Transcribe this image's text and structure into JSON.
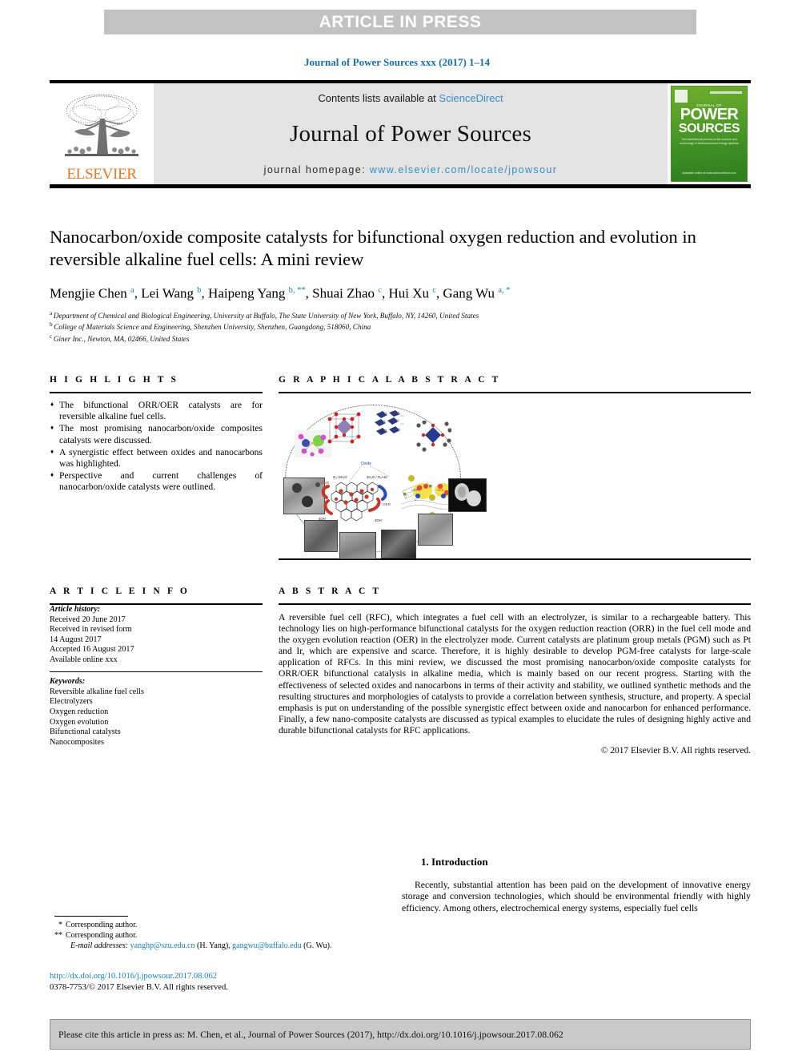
{
  "banner": {
    "text": "ARTICLE IN PRESS"
  },
  "running_head": "Journal of Power Sources xxx (2017) 1–14",
  "masthead": {
    "contents_prefix": "Contents lists available at ",
    "sciencedirect": "ScienceDirect",
    "journal_name": "Journal of Power Sources",
    "homepage_prefix": "journal homepage: ",
    "homepage_url": "www.elsevier.com/locate/jpowsour",
    "publisher_logo_text": "ELSEVIER",
    "publisher_logo_icon": "elsevier-tree-icon",
    "cover": {
      "kicker": "JOURNAL OF",
      "title_line1": "POWER",
      "title_line2": "SOURCES",
      "subtitle": "The international journal on the science and technology of electrochemical energy systems",
      "footer": "Available online at www.sciencedirect.com",
      "accent_color": "#4a9b28"
    }
  },
  "article": {
    "title": "Nanocarbon/oxide composite catalysts for bifunctional oxygen reduction and evolution in reversible alkaline fuel cells: A mini review",
    "authors": [
      {
        "name": "Mengjie Chen",
        "marks": "a",
        "sep": ", "
      },
      {
        "name": "Lei Wang",
        "marks": "b",
        "sep": ", "
      },
      {
        "name": "Haipeng Yang",
        "marks": "b, **",
        "sep": ", "
      },
      {
        "name": "Shuai Zhao",
        "marks": "c",
        "sep": ", "
      },
      {
        "name": "Hui Xu",
        "marks": "c",
        "sep": ", "
      },
      {
        "name": "Gang Wu",
        "marks": "a, *",
        "sep": ""
      }
    ],
    "affiliations": [
      {
        "mark": "a",
        "text": "Department of Chemical and Biological Engineering, University at Buffalo, The State University of New York, Buffalo, NY, 14260, United States"
      },
      {
        "mark": "b",
        "text": "College of Materials Science and Engineering, Shenzhen University, Shenzhen, Guangdong, 518060, China"
      },
      {
        "mark": "c",
        "text": "Giner Inc., Newton, MA, 02466, United States"
      }
    ]
  },
  "highlights": {
    "heading": "H I G H L I G H T S",
    "items": [
      "The bifunctional ORR/OER catalysts are for reversible alkaline fuel cells.",
      "The most promising nanocarbon/oxide composites catalysts were discussed.",
      "A synergistic effect between oxides and nanocarbons was highlighted.",
      "Perspective and current challenges of nanocarbon/oxide catalysts were outlined."
    ]
  },
  "graphical_abstract": {
    "heading": "G R A P H I C A L   A B S T R A C T",
    "figure_alt": "graphical-abstract-figure",
    "labels": {
      "oxide": "Oxide",
      "orr": "ORR",
      "oer": "OER",
      "reactant_left": "O₂ + 2H₂O",
      "reactant_right": "2H₂O / O₂ + 4e⁻",
      "product_left": "4OH⁻",
      "product_right": "4OH⁻"
    }
  },
  "article_info": {
    "heading": "A R T I C L E   I N F O",
    "history_label": "Article history:",
    "history": [
      "Received 20 June 2017",
      "Received in revised form",
      "14 August 2017",
      "Accepted 16 August 2017",
      "Available online xxx"
    ],
    "keywords_label": "Keywords:",
    "keywords": [
      "Reversible alkaline fuel cells",
      "Electrolyzers",
      "Oxygen reduction",
      "Oxygen evolution",
      "Bifunctional catalysts",
      "Nanocomposites"
    ]
  },
  "abstract": {
    "heading": "A B S T R A C T",
    "text": "A reversible fuel cell (RFC), which integrates a fuel cell with an electrolyzer, is similar to a rechargeable battery. This technology lies on high-performance bifunctional catalysts for the oxygen reduction reaction (ORR) in the fuel cell mode and the oxygen evolution reaction (OER) in the electrolyzer mode. Current catalysts are platinum group metals (PGM) such as Pt and Ir, which are expensive and scarce. Therefore, it is highly desirable to develop PGM-free catalysts for large-scale application of RFCs. In this mini review, we discussed the most promising nanocarbon/oxide composite catalysts for ORR/OER bifunctional catalysis in alkaline media, which is mainly based on our recent progress. Starting with the effectiveness of selected oxides and nanocarbons in terms of their activity and stability, we outlined synthetic methods and the resulting structures and morphologies of catalysts to provide a correlation between synthesis, structure, and property. A special emphasis is put on understanding of the possible synergistic effect between oxide and nanocarbon for enhanced performance. Finally, a few nano-composite catalysts are discussed as typical examples to elucidate the rules of designing highly active and durable bifunctional catalysts for RFC applications.",
    "copyright": "© 2017 Elsevier B.V. All rights reserved."
  },
  "introduction": {
    "heading": "1. Introduction",
    "paragraph": "Recently, substantial attention has been paid on the development of innovative energy storage and conversion technologies, which should be environmental friendly with highly efficiency. Among others, electrochemical energy systems, especially fuel cells"
  },
  "footnotes": {
    "corresponding_1_mark": "*",
    "corresponding_1": "Corresponding author.",
    "corresponding_2_mark": "**",
    "corresponding_2": "Corresponding author.",
    "email_label": "E-mail addresses:",
    "email_1": "yanghp@szu.edu.cn",
    "email_1_owner": "(H. Yang),",
    "email_2": "gangwu@buffalo.edu",
    "email_2_owner": "(G. Wu)."
  },
  "doi": {
    "url": "http://dx.doi.org/10.1016/j.jpowsour.2017.08.062",
    "issn_line": "0378-7753/© 2017 Elsevier B.V. All rights reserved."
  },
  "cite_footer": {
    "text": "Please cite this article in press as: M. Chen, et al., Journal of Power Sources (2017), http://dx.doi.org/10.1016/j.jpowsour.2017.08.062"
  },
  "colors": {
    "link_blue": "#1a7fb5",
    "sciencedirect_blue": "#3a8fc4",
    "elsevier_orange": "#e87722",
    "banner_gray": "#c2c2c3",
    "masthead_gray": "#e3e3e3",
    "cite_gray": "#c9c9c9",
    "oval_green": "#2e6b2e"
  }
}
